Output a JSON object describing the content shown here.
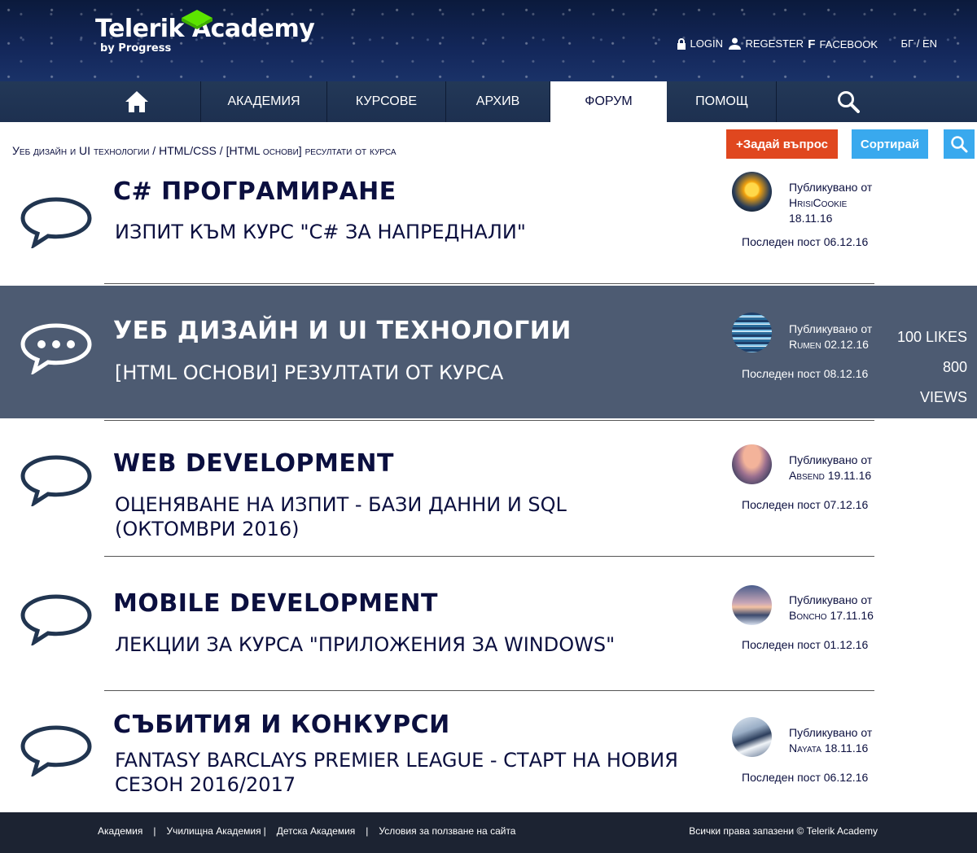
{
  "header": {
    "logo_title": "Telerik Academy",
    "logo_sub": "by Progress",
    "login": "LOGIN",
    "register": "REGESTER",
    "facebook": "FACEBOOK",
    "lang": "БГ / EN"
  },
  "nav": {
    "items": [
      {
        "label": "АКАДЕМИЯ"
      },
      {
        "label": "КУРСОВЕ"
      },
      {
        "label": "АРХИВ"
      },
      {
        "label": "ФОРУМ"
      },
      {
        "label": "ПОМОЩ"
      }
    ],
    "active": "ФОРУМ"
  },
  "breadcrumb": {
    "parts": [
      "Уеб дизайн и UI технологии",
      "HTML/CSS",
      "[HTML основи] ресултати от курса"
    ],
    "sep": " / "
  },
  "toolbar": {
    "ask_label": "+Задай въпрос",
    "sort_label": "Сортирай"
  },
  "topics": [
    {
      "category": "C# ПРОГРАМИРАНЕ",
      "title": "ИЗПИТ КЪМ КУРС \"C# ЗА НАПРЕДНАЛИ\"",
      "published_label": "Публикувано от",
      "user": "HrisiCookie",
      "date": "18.11.16",
      "last_post": "Последен пост 06.12.16"
    },
    {
      "category": "УЕБ ДИЗАЙН И UI ТЕХНОЛОГИИ",
      "title": "[HTML ОСНОВИ] РЕЗУЛТАТИ ОТ КУРСА",
      "published_label": "Публикувано от",
      "user": "Rumen",
      "date": "02.12.16",
      "last_post": "Последен пост 08.12.16",
      "likes": "100 LIKES",
      "views": "800 VIEWS"
    },
    {
      "category": "WEB DEVELOPMENT",
      "title": "ОЦЕНЯВАНЕ НА ИЗПИТ - БАЗИ ДАННИ И SQL (ОКТОМВРИ 2016)",
      "published_label": "Публикувано от",
      "user": "Absend",
      "date": "19.11.16",
      "last_post": "Последен пост 07.12.16"
    },
    {
      "category": "MOBILE DEVELOPMENT",
      "title": "ЛЕКЦИИ ЗА КУРСА \"ПРИЛОЖЕНИЯ ЗА WINDOWS\"",
      "published_label": "Публикувано от",
      "user": "Boncho",
      "date": "17.11.16",
      "last_post": "Последен пост 01.12.16"
    },
    {
      "category": "СЪБИТИЯ И КОНКУРСИ",
      "title": "FANTASY BARCLAYS PREMIER LEAGUE - СТАРТ НА НОВИЯ СЕЗОН 2016/2017",
      "published_label": "Публикувано от",
      "user": "Nayata",
      "date": "18.11.16",
      "last_post": "Последен пост 06.12.16"
    }
  ],
  "footer": {
    "links": [
      "Академия",
      "Училищна Академия",
      "Детска Академия",
      "Условия за ползване на сайта"
    ],
    "copyright": "Всички права запазени  ©  Telerik Academy"
  }
}
